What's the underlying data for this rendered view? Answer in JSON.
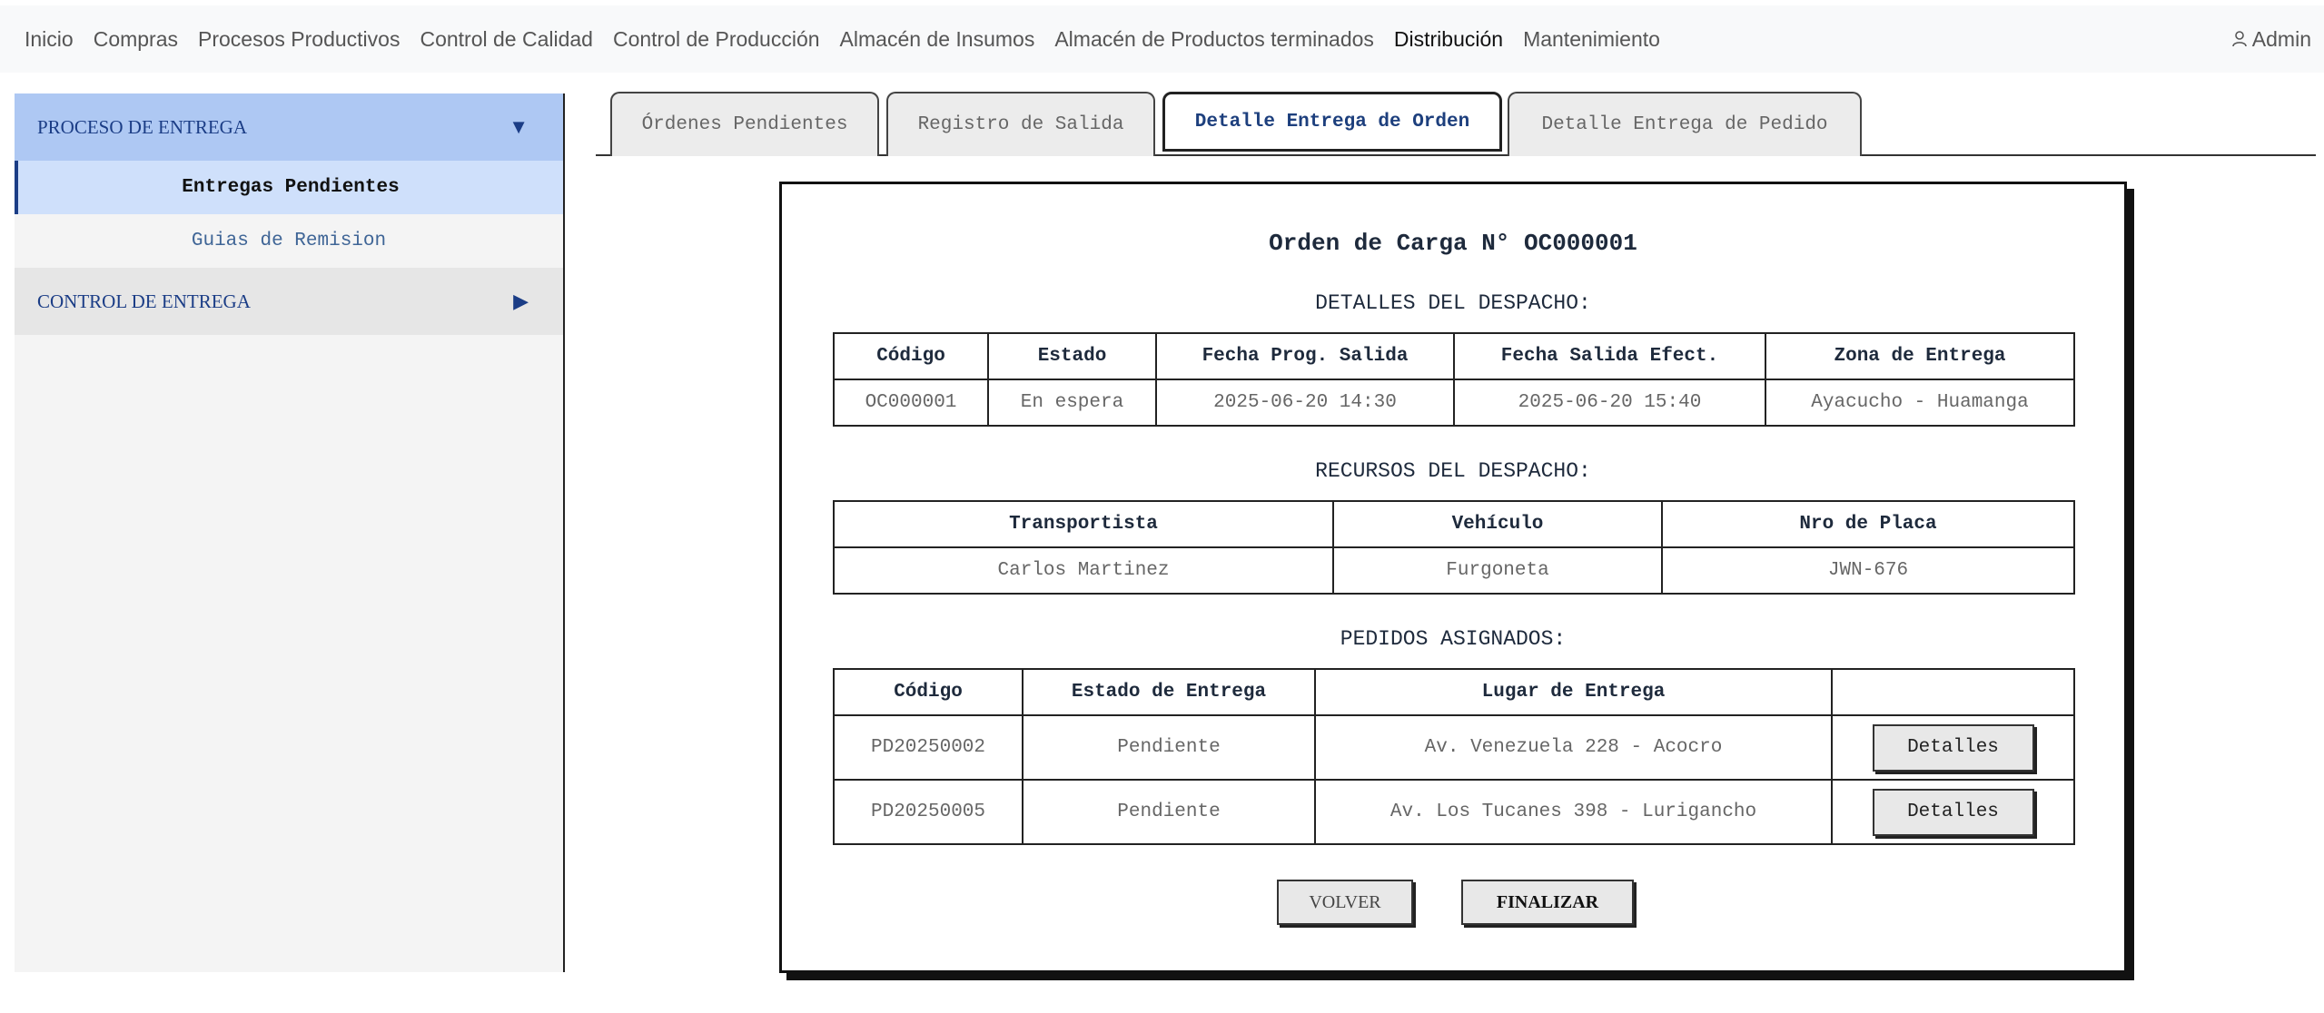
{
  "nav": {
    "items": [
      "Inicio",
      "Compras",
      "Procesos Productivos",
      "Control de Calidad",
      "Control de Producción",
      "Almacén de Insumos",
      "Almacén de Productos terminados",
      "Distribución",
      "Mantenimiento"
    ],
    "active": "Distribución",
    "user": "Admin",
    "user_icon": "user-icon"
  },
  "sidebar": {
    "sections": [
      {
        "label": "PROCESO DE ENTREGA",
        "state": "open",
        "icon": "triangle-down-icon",
        "items": [
          {
            "label": "Entregas Pendientes",
            "active": true
          },
          {
            "label": "Guias de Remision",
            "active": false
          }
        ]
      },
      {
        "label": "CONTROL DE ENTREGA",
        "state": "closed",
        "icon": "triangle-right-icon",
        "items": []
      }
    ]
  },
  "tabs": [
    {
      "label": "Órdenes Pendientes",
      "active": false
    },
    {
      "label": "Registro de Salida",
      "active": false
    },
    {
      "label": "Detalle Entrega de Orden",
      "active": true
    },
    {
      "label": "Detalle Entrega de Pedido",
      "active": false
    }
  ],
  "card": {
    "title": "Orden de Carga N° OC000001",
    "despacho": {
      "title": "DETALLES DEL DESPACHO:",
      "headers": [
        "Código",
        "Estado",
        "Fecha Prog. Salida",
        "Fecha Salida Efect.",
        "Zona de Entrega"
      ],
      "row": [
        "OC000001",
        "En espera",
        "2025-06-20 14:30",
        "2025-06-20 15:40",
        "Ayacucho - Huamanga"
      ]
    },
    "recursos": {
      "title": "RECURSOS DEL DESPACHO:",
      "headers": [
        "Transportista",
        "Vehículo",
        "Nro de Placa"
      ],
      "row": [
        "Carlos Martinez",
        "Furgoneta",
        "JWN-676"
      ]
    },
    "pedidos": {
      "title": "PEDIDOS ASIGNADOS:",
      "headers": [
        "Código",
        "Estado de Entrega",
        "Lugar de Entrega",
        ""
      ],
      "rows": [
        {
          "codigo": "PD20250002",
          "estado": "Pendiente",
          "lugar": "Av. Venezuela 228 - Acocro",
          "button": "Detalles"
        },
        {
          "codigo": "PD20250005",
          "estado": "Pendiente",
          "lugar": "Av. Los Tucanes 398 - Lurigancho",
          "button": "Detalles"
        }
      ]
    },
    "buttons": {
      "back": "VOLVER",
      "finish": "FINALIZAR"
    }
  },
  "colors": {
    "sidebar_open": "#aec8f3",
    "sidebar_active": "#cfe0fb",
    "accent": "#1b3d86"
  }
}
